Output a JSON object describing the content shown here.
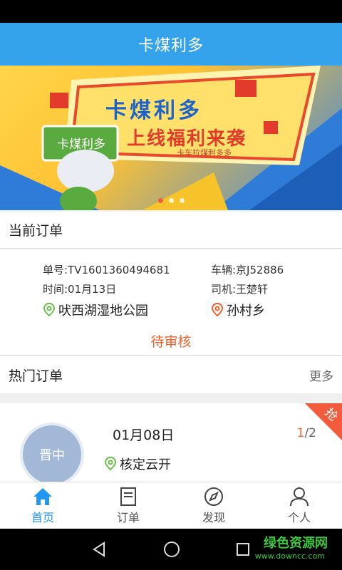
{
  "header": {
    "title": "卡煤利多"
  },
  "banner": {
    "sign_title": "卡煤利多",
    "headline_top": "卡煤利多",
    "headline_main": "上线福利来袭",
    "headline_sub": "卡车拉煤利多多",
    "active_dot": 0,
    "dot_count": 3
  },
  "current_orders": {
    "section_label": "当前订单",
    "order_no": "单号:TV1601360494681",
    "vehicle": "车辆:京J52886",
    "time": "时间:01月13日",
    "driver": "司机:王楚轩",
    "origin": "吠西湖湿地公园",
    "destination": "孙村乡",
    "status": "待审核"
  },
  "hot_orders": {
    "section_label": "热门订单",
    "more_label": "更多",
    "item": {
      "avatar_text": "晋中",
      "date": "01月08日",
      "current": "1",
      "total": "/2",
      "origin": "核定云开",
      "ribbon": "抢"
    }
  },
  "tabs": [
    {
      "label": "首页",
      "icon": "home-icon",
      "active": true
    },
    {
      "label": "订单",
      "icon": "order-icon",
      "active": false
    },
    {
      "label": "发现",
      "icon": "compass-icon",
      "active": false
    },
    {
      "label": "个人",
      "icon": "person-icon",
      "active": false
    }
  ],
  "watermark": {
    "title": "绿色资源网",
    "url": "www.downcc.com"
  },
  "colors": {
    "primary": "#35a3ec",
    "accent": "#f0622b",
    "tab_active": "#2196f3"
  }
}
